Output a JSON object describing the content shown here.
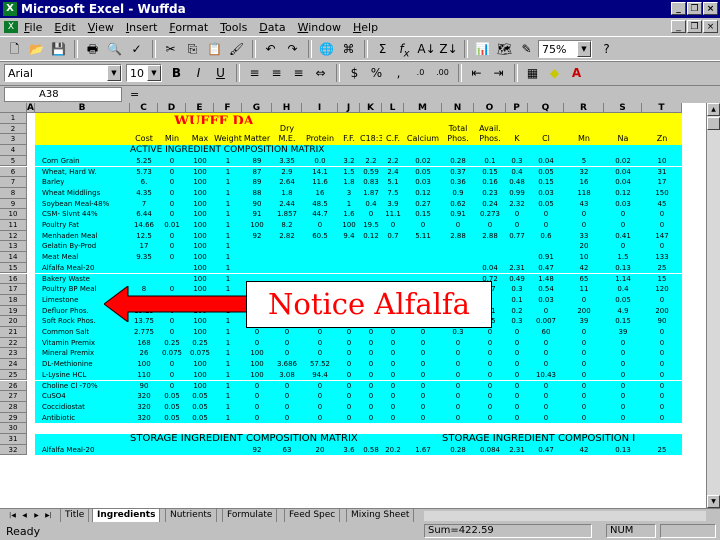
{
  "window": {
    "title": "Microsoft Excel - Wuffda",
    "app_icon": "excel-icon"
  },
  "menu": [
    {
      "u": "F",
      "rest": "ile"
    },
    {
      "u": "E",
      "rest": "dit"
    },
    {
      "u": "V",
      "rest": "iew"
    },
    {
      "u": "I",
      "rest": "nsert"
    },
    {
      "u": "F",
      "rest": "ormat"
    },
    {
      "u": "T",
      "rest": "ools"
    },
    {
      "u": "D",
      "rest": "ata"
    },
    {
      "u": "W",
      "rest": "indow"
    },
    {
      "u": "H",
      "rest": "elp"
    }
  ],
  "toolbar": {
    "zoom": "75%",
    "font": "Arial",
    "font_size": "10"
  },
  "formula_bar": {
    "name_box": "A38",
    "eq": "="
  },
  "columns": [
    "A",
    "B",
    "C",
    "D",
    "E",
    "F",
    "G",
    "H",
    "I",
    "J",
    "K",
    "L",
    "M",
    "N",
    "O",
    "P",
    "Q",
    "R",
    "S",
    "T"
  ],
  "sheet": {
    "title": "WUFFF DA",
    "header1": {
      "dry": "Dry",
      "total": "Total",
      "avail": "Avail."
    },
    "header2": [
      "Cost",
      "Min",
      "Max",
      "Weight",
      "Matter",
      "M.E.",
      "Protein",
      "F.F.",
      "C18:3",
      "C.F.",
      "Calcium",
      "Phos.",
      "Phos.",
      "K",
      "Cl",
      "Mn",
      "Na",
      "Zn"
    ],
    "section1": "ACTIVE INGREDIENT COMPOSITION MATRIX",
    "section2_left": "STORAGE INGREDIENT COMPOSITION MATRIX",
    "section2_right": "STORAGE INGREDIENT COMPOSITION I",
    "rows": [
      {
        "n": "5",
        "name": "Corn Grain",
        "v": [
          "5.25",
          "0",
          "100",
          "1",
          "89",
          "3.35",
          "0.0",
          "3.2",
          "2.2",
          "2.2",
          "0.02",
          "0.28",
          "0.1",
          "0.3",
          "0.04",
          "5",
          "0.02",
          "10"
        ]
      },
      {
        "n": "6",
        "name": "Wheat, Hard W.",
        "v": [
          "5.73",
          "0",
          "100",
          "1",
          "87",
          "2.9",
          "14.1",
          "1.5",
          "0.59",
          "2.4",
          "0.05",
          "0.37",
          "0.15",
          "0.4",
          "0.05",
          "32",
          "0.04",
          "31"
        ]
      },
      {
        "n": "7",
        "name": "Barley",
        "v": [
          "6.",
          "0",
          "100",
          "1",
          "89",
          "2.64",
          "11.6",
          "1.8",
          "0.83",
          "5.1",
          "0.03",
          "0.36",
          "0.16",
          "0.48",
          "0.15",
          "16",
          "0.04",
          "17"
        ]
      },
      {
        "n": "8",
        "name": "Wheat Middlings",
        "v": [
          "4.35",
          "0",
          "100",
          "1",
          "88",
          "1.8",
          "16",
          "3",
          "1.87",
          "7.5",
          "0.12",
          "0.9",
          "0.23",
          "0.99",
          "0.03",
          "118",
          "0.12",
          "150"
        ]
      },
      {
        "n": "9",
        "name": "Soybean Meal-48%",
        "v": [
          "7",
          "0",
          "100",
          "1",
          "90",
          "2.44",
          "48.5",
          "1",
          "0.4",
          "3.9",
          "0.27",
          "0.62",
          "0.24",
          "2.32",
          "0.05",
          "43",
          "0.03",
          "45"
        ]
      },
      {
        "n": "10",
        "name": "CSM- Slvnt 44%",
        "v": [
          "6.44",
          "0",
          "100",
          "1",
          "91",
          "1.857",
          "44.7",
          "1.6",
          "0",
          "11.1",
          "0.15",
          "0.91",
          "0.273",
          "0",
          "0",
          "0",
          "0",
          "0"
        ]
      },
      {
        "n": "11",
        "name": "Poultry Fat",
        "v": [
          "14.66",
          "0.01",
          "100",
          "1",
          "100",
          "8.2",
          "0",
          "100",
          "19.5",
          "0",
          "0",
          "0",
          "0",
          "0",
          "0",
          "0",
          "0",
          "0"
        ]
      },
      {
        "n": "12",
        "name": "Menhaden Meal",
        "v": [
          "12.5",
          "0",
          "100",
          "1",
          "92",
          "2.82",
          "60.5",
          "9.4",
          "0.12",
          "0.7",
          "5.11",
          "2.88",
          "2.88",
          "0.77",
          "0.6",
          "33",
          "0.41",
          "147"
        ]
      },
      {
        "n": "13",
        "name": "Gelatin By-Prod",
        "v": [
          "17",
          "0",
          "100",
          "1",
          "",
          "",
          "",
          "",
          "",
          "",
          "",
          "",
          "",
          "",
          "",
          "20",
          "0",
          "0"
        ]
      },
      {
        "n": "14",
        "name": "Meat Meal",
        "v": [
          "9.35",
          "0",
          "100",
          "1",
          "",
          "",
          "",
          "",
          "",
          "",
          "",
          "",
          "",
          "",
          "0.91",
          "10",
          "1.5",
          "133"
        ]
      },
      {
        "n": "15",
        "name": "Alfalfa Meal-20",
        "v": [
          "",
          "",
          "100",
          "1",
          "",
          "",
          "",
          "",
          "",
          "",
          "",
          "",
          "0.04",
          "2.31",
          "0.47",
          "42",
          "0.13",
          "25"
        ]
      },
      {
        "n": "16",
        "name": "Bakery Waste",
        "v": [
          "",
          "",
          "100",
          "1",
          "",
          "",
          "",
          "",
          "",
          "",
          "",
          "",
          "0.72",
          "0.49",
          "1.48",
          "65",
          "1.14",
          "15"
        ]
      },
      {
        "n": "17",
        "name": "Poultry BP Meal",
        "v": [
          "8",
          "0",
          "100",
          "1",
          "",
          "",
          "",
          "",
          "",
          "",
          "",
          "",
          "0.7",
          "0.3",
          "0.54",
          "11",
          "0.4",
          "120"
        ]
      },
      {
        "n": "18",
        "name": "Limestone",
        "v": [
          "1.525",
          "0",
          "100",
          "1",
          "0",
          "0",
          "0",
          "0",
          "0",
          "0",
          "35",
          "0.02",
          "0",
          "0.1",
          "0.03",
          "0",
          "0.05",
          "0"
        ]
      },
      {
        "n": "19",
        "name": "Defluor Phos.",
        "v": [
          "13.25",
          "0",
          "100",
          "1",
          "0",
          "0",
          "0",
          "0",
          "0",
          "0",
          "32",
          "18",
          "0.1",
          "0.2",
          "0",
          "200",
          "4.9",
          "200"
        ]
      },
      {
        "n": "20",
        "name": "Soft Rock Phos.",
        "v": [
          "13.75",
          "0",
          "100",
          "1",
          "0",
          "0",
          "0",
          "0",
          "0",
          "0",
          "17.5",
          "9.5",
          "9.5",
          "0.3",
          "0.007",
          "39",
          "0.15",
          "90"
        ]
      },
      {
        "n": "21",
        "name": "Common Salt",
        "v": [
          "2.775",
          "0",
          "100",
          "1",
          "0",
          "0",
          "0",
          "0",
          "0",
          "0",
          "0",
          "0.3",
          "0",
          "0",
          "60",
          "0",
          "39",
          "0"
        ]
      },
      {
        "n": "22",
        "name": "Vitamin Premix",
        "v": [
          "168",
          "0.25",
          "0.25",
          "1",
          "0",
          "0",
          "0",
          "0",
          "0",
          "0",
          "0",
          "0",
          "0",
          "0",
          "0",
          "0",
          "0",
          "0"
        ]
      },
      {
        "n": "23",
        "name": "Mineral Premix",
        "v": [
          "26",
          "0.075",
          "0.075",
          "1",
          "100",
          "0",
          "0",
          "0",
          "0",
          "0",
          "0",
          "0",
          "0",
          "0",
          "0",
          "0",
          "0",
          "0"
        ]
      },
      {
        "n": "24",
        "name": "DL-Methionine",
        "v": [
          "100",
          "0",
          "100",
          "1",
          "100",
          "3.686",
          "57.52",
          "0",
          "0",
          "0",
          "0",
          "0",
          "0",
          "0",
          "0",
          "0",
          "0",
          "0"
        ]
      },
      {
        "n": "25",
        "name": "L-Lysine HCL",
        "v": [
          "110",
          "0",
          "100",
          "1",
          "100",
          "3.08",
          "94.4",
          "0",
          "0",
          "0",
          "0",
          "0",
          "0",
          "0",
          "10.43",
          "0",
          "0",
          "0"
        ]
      },
      {
        "n": "26",
        "name": "Choline Cl -70%",
        "v": [
          "90",
          "0",
          "100",
          "1",
          "0",
          "0",
          "0",
          "0",
          "0",
          "0",
          "0",
          "0",
          "0",
          "0",
          "0",
          "0",
          "0",
          "0"
        ]
      },
      {
        "n": "27",
        "name": "CuSO4",
        "v": [
          "320",
          "0.05",
          "0.05",
          "1",
          "0",
          "0",
          "0",
          "0",
          "0",
          "0",
          "0",
          "0",
          "0",
          "0",
          "0",
          "0",
          "0",
          "0"
        ]
      },
      {
        "n": "28",
        "name": "Coccidiostat",
        "v": [
          "320",
          "0.05",
          "0.05",
          "1",
          "0",
          "0",
          "0",
          "0",
          "0",
          "0",
          "0",
          "0",
          "0",
          "0",
          "0",
          "0",
          "0",
          "0"
        ]
      },
      {
        "n": "29",
        "name": "Antibiotic",
        "v": [
          "320",
          "0.05",
          "0.05",
          "1",
          "0",
          "0",
          "0",
          "0",
          "0",
          "0",
          "0",
          "0",
          "0",
          "0",
          "0",
          "0",
          "0",
          "0"
        ]
      }
    ],
    "row32": {
      "n": "32",
      "name": "Alfalfa Meal-20",
      "v": [
        "",
        "",
        "",
        "",
        "92",
        "63",
        "20",
        "3.6",
        "0.58",
        "20.2",
        "1.67",
        "0.28",
        "0.084",
        "2.31",
        "0.47",
        "42",
        "0.13",
        "25"
      ]
    }
  },
  "callout": {
    "text": "Notice Alfalfa"
  },
  "tabs": [
    "Title",
    "Ingredients",
    "Nutrients",
    "Formulate",
    "Feed Spec",
    "Mixing Sheet"
  ],
  "active_tab": "Ingredients",
  "status": {
    "ready": "Ready",
    "sum": "Sum=422.59",
    "num": "NUM"
  }
}
